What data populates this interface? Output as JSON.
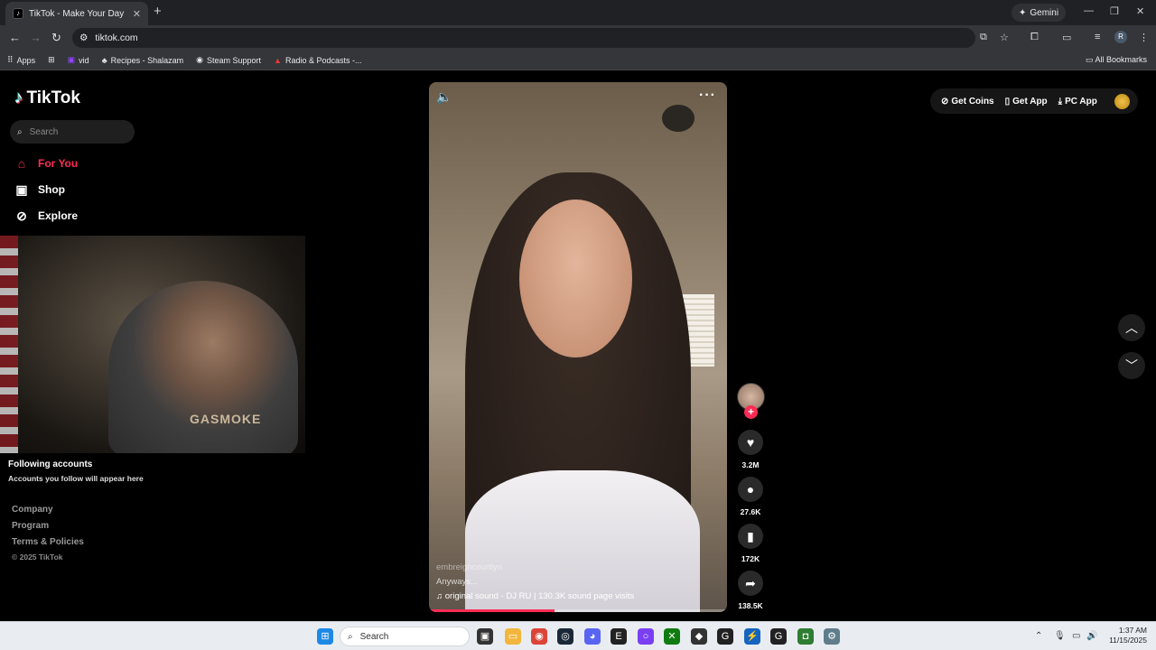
{
  "browser": {
    "tab_title": "TikTok - Make Your Day",
    "tab_close": "✕",
    "new_tab": "+",
    "gemini_label": "Gemini",
    "url": "tiktok.com",
    "profile_initial": "R",
    "bookmarks": [
      {
        "label": "Apps"
      },
      {
        "label": "vid"
      },
      {
        "label": "Recipes - Shalazam"
      },
      {
        "label": "Steam Support"
      },
      {
        "label": "Radio & Podcasts -..."
      }
    ],
    "all_bookmarks": "All Bookmarks"
  },
  "tiktok": {
    "logo": "TikTok",
    "search_placeholder": "Search",
    "nav": {
      "for_you": "For You",
      "shop": "Shop",
      "explore": "Explore"
    },
    "webcam_shirt": "GASMOKE",
    "following": {
      "title": "Following accounts",
      "subtitle": "Accounts you follow will appear here"
    },
    "footer": {
      "company": "Company",
      "program": "Program",
      "terms": "Terms & Policies",
      "copyright": "© 2025 TikTok"
    },
    "top_buttons": {
      "get_coins": "Get Coins",
      "get_app": "Get App",
      "pc_app": "PC App"
    },
    "video": {
      "username": "embreighcourtlyn",
      "description": "Anyways...",
      "sound": "original sound - DJ RU | 130.3K sound page visits",
      "progress_fraction": 0.42
    },
    "actions": {
      "likes": "3.2M",
      "comments": "27.6K",
      "saves": "172K",
      "shares": "138.5K"
    }
  },
  "taskbar": {
    "search": "Search",
    "time": "1:37 AM",
    "date": "11/15/2025"
  },
  "colors": {
    "accent": "#fe2c55",
    "background": "#000000"
  }
}
